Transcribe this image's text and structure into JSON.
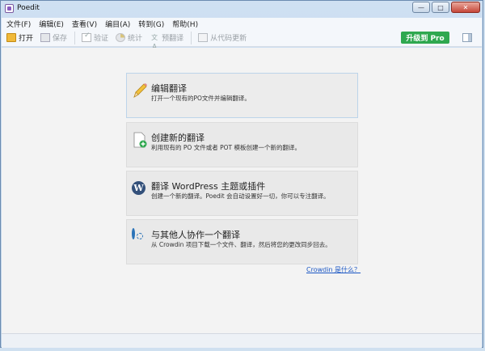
{
  "window": {
    "title": "Poedit",
    "controls": {
      "minimize": "—",
      "maximize": "□",
      "close": "✕"
    }
  },
  "menu": [
    {
      "label": "文件(F)"
    },
    {
      "label": "编辑(E)"
    },
    {
      "label": "查看(V)"
    },
    {
      "label": "编目(A)"
    },
    {
      "label": "转到(G)"
    },
    {
      "label": "帮助(H)"
    }
  ],
  "toolbar": {
    "open": "打开",
    "save": "保存",
    "validate": "验证",
    "stats": "统计",
    "pretranslate": "预翻译",
    "update_from_code": "从代码更新",
    "upgrade": "升级到 Pro"
  },
  "welcome": {
    "cards": [
      {
        "title": "编辑翻译",
        "desc": "打开一个现有的PO文件并编辑翻译。"
      },
      {
        "title": "创建新的翻译",
        "desc": "利用现有的 PO 文件或者 POT 模板创建一个新的翻译。"
      },
      {
        "title": "翻译 WordPress 主题或插件",
        "desc": "创建一个新的翻译。Poedit 会自动设置好一切，你可以专注翻译。"
      },
      {
        "title": "与其他人协作一个翻译",
        "desc": "从 Crowdin 项目下载一个文件、翻译，然后将您的更改同步回去。"
      }
    ],
    "help_link": "Crowdin 是什么？"
  },
  "icons": {
    "wordpress_letter": "W"
  },
  "colors": {
    "upgrade_green": "#2fa84f",
    "link_blue": "#1a56c4"
  }
}
